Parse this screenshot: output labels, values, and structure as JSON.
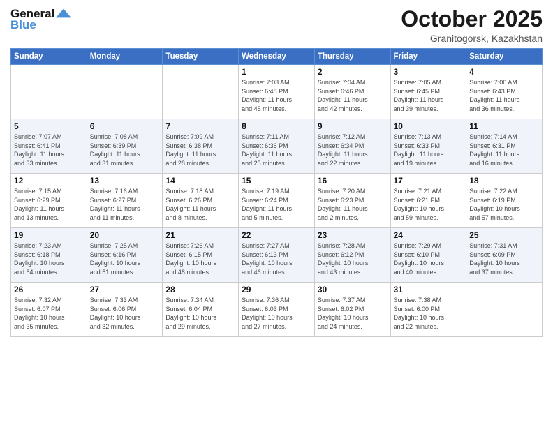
{
  "header": {
    "logo_general": "General",
    "logo_blue": "Blue",
    "month": "October 2025",
    "location": "Granitogorsk, Kazakhstan"
  },
  "days_of_week": [
    "Sunday",
    "Monday",
    "Tuesday",
    "Wednesday",
    "Thursday",
    "Friday",
    "Saturday"
  ],
  "weeks": [
    {
      "shaded": false,
      "days": [
        {
          "num": "",
          "info": ""
        },
        {
          "num": "",
          "info": ""
        },
        {
          "num": "",
          "info": ""
        },
        {
          "num": "1",
          "info": "Sunrise: 7:03 AM\nSunset: 6:48 PM\nDaylight: 11 hours\nand 45 minutes."
        },
        {
          "num": "2",
          "info": "Sunrise: 7:04 AM\nSunset: 6:46 PM\nDaylight: 11 hours\nand 42 minutes."
        },
        {
          "num": "3",
          "info": "Sunrise: 7:05 AM\nSunset: 6:45 PM\nDaylight: 11 hours\nand 39 minutes."
        },
        {
          "num": "4",
          "info": "Sunrise: 7:06 AM\nSunset: 6:43 PM\nDaylight: 11 hours\nand 36 minutes."
        }
      ]
    },
    {
      "shaded": true,
      "days": [
        {
          "num": "5",
          "info": "Sunrise: 7:07 AM\nSunset: 6:41 PM\nDaylight: 11 hours\nand 33 minutes."
        },
        {
          "num": "6",
          "info": "Sunrise: 7:08 AM\nSunset: 6:39 PM\nDaylight: 11 hours\nand 31 minutes."
        },
        {
          "num": "7",
          "info": "Sunrise: 7:09 AM\nSunset: 6:38 PM\nDaylight: 11 hours\nand 28 minutes."
        },
        {
          "num": "8",
          "info": "Sunrise: 7:11 AM\nSunset: 6:36 PM\nDaylight: 11 hours\nand 25 minutes."
        },
        {
          "num": "9",
          "info": "Sunrise: 7:12 AM\nSunset: 6:34 PM\nDaylight: 11 hours\nand 22 minutes."
        },
        {
          "num": "10",
          "info": "Sunrise: 7:13 AM\nSunset: 6:33 PM\nDaylight: 11 hours\nand 19 minutes."
        },
        {
          "num": "11",
          "info": "Sunrise: 7:14 AM\nSunset: 6:31 PM\nDaylight: 11 hours\nand 16 minutes."
        }
      ]
    },
    {
      "shaded": false,
      "days": [
        {
          "num": "12",
          "info": "Sunrise: 7:15 AM\nSunset: 6:29 PM\nDaylight: 11 hours\nand 13 minutes."
        },
        {
          "num": "13",
          "info": "Sunrise: 7:16 AM\nSunset: 6:27 PM\nDaylight: 11 hours\nand 11 minutes."
        },
        {
          "num": "14",
          "info": "Sunrise: 7:18 AM\nSunset: 6:26 PM\nDaylight: 11 hours\nand 8 minutes."
        },
        {
          "num": "15",
          "info": "Sunrise: 7:19 AM\nSunset: 6:24 PM\nDaylight: 11 hours\nand 5 minutes."
        },
        {
          "num": "16",
          "info": "Sunrise: 7:20 AM\nSunset: 6:23 PM\nDaylight: 11 hours\nand 2 minutes."
        },
        {
          "num": "17",
          "info": "Sunrise: 7:21 AM\nSunset: 6:21 PM\nDaylight: 10 hours\nand 59 minutes."
        },
        {
          "num": "18",
          "info": "Sunrise: 7:22 AM\nSunset: 6:19 PM\nDaylight: 10 hours\nand 57 minutes."
        }
      ]
    },
    {
      "shaded": true,
      "days": [
        {
          "num": "19",
          "info": "Sunrise: 7:23 AM\nSunset: 6:18 PM\nDaylight: 10 hours\nand 54 minutes."
        },
        {
          "num": "20",
          "info": "Sunrise: 7:25 AM\nSunset: 6:16 PM\nDaylight: 10 hours\nand 51 minutes."
        },
        {
          "num": "21",
          "info": "Sunrise: 7:26 AM\nSunset: 6:15 PM\nDaylight: 10 hours\nand 48 minutes."
        },
        {
          "num": "22",
          "info": "Sunrise: 7:27 AM\nSunset: 6:13 PM\nDaylight: 10 hours\nand 46 minutes."
        },
        {
          "num": "23",
          "info": "Sunrise: 7:28 AM\nSunset: 6:12 PM\nDaylight: 10 hours\nand 43 minutes."
        },
        {
          "num": "24",
          "info": "Sunrise: 7:29 AM\nSunset: 6:10 PM\nDaylight: 10 hours\nand 40 minutes."
        },
        {
          "num": "25",
          "info": "Sunrise: 7:31 AM\nSunset: 6:09 PM\nDaylight: 10 hours\nand 37 minutes."
        }
      ]
    },
    {
      "shaded": false,
      "days": [
        {
          "num": "26",
          "info": "Sunrise: 7:32 AM\nSunset: 6:07 PM\nDaylight: 10 hours\nand 35 minutes."
        },
        {
          "num": "27",
          "info": "Sunrise: 7:33 AM\nSunset: 6:06 PM\nDaylight: 10 hours\nand 32 minutes."
        },
        {
          "num": "28",
          "info": "Sunrise: 7:34 AM\nSunset: 6:04 PM\nDaylight: 10 hours\nand 29 minutes."
        },
        {
          "num": "29",
          "info": "Sunrise: 7:36 AM\nSunset: 6:03 PM\nDaylight: 10 hours\nand 27 minutes."
        },
        {
          "num": "30",
          "info": "Sunrise: 7:37 AM\nSunset: 6:02 PM\nDaylight: 10 hours\nand 24 minutes."
        },
        {
          "num": "31",
          "info": "Sunrise: 7:38 AM\nSunset: 6:00 PM\nDaylight: 10 hours\nand 22 minutes."
        },
        {
          "num": "",
          "info": ""
        }
      ]
    }
  ]
}
